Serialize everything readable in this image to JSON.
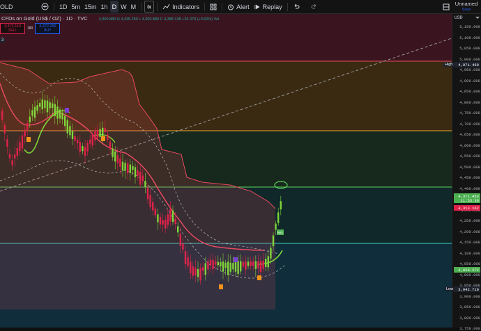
{
  "toolbar": {
    "symbol": "OLD",
    "add_icon": "plus-circle-icon",
    "intervals": [
      "1D",
      "5m",
      "15m",
      "1h",
      "D",
      "W",
      "M"
    ],
    "active_interval": "D",
    "chart_type_icon": "candles-icon",
    "indicators_label": "Indicators",
    "alert_label": "Alert",
    "replay_label": "Replay",
    "layout_name": "Unnamed",
    "layout_sub": "Save"
  },
  "legend": {
    "title": "CFDs on Gold (US$ / OZ) · 1D · TVC",
    "ohlc": "4,300.880 H 4,435.250 L 4,300.880 C 4,388.138 +26.378 (+0.60%) Vol",
    "sell_price": "4,372.110",
    "sell_label": "SELL",
    "spread": "180",
    "buy_price": "4,372.290",
    "buy_label": "BUY",
    "count": "3"
  },
  "axis": {
    "currency": "USD",
    "ticks": [
      "5,150.000",
      "5,100.000",
      "5,050.000",
      "5,000.000",
      "4,950.000",
      "4,900.000",
      "4,850.000",
      "4,800.000",
      "4,750.000",
      "4,700.000",
      "4,650.000",
      "4,600.000",
      "4,550.000",
      "4,500.000",
      "4,450.000",
      "4,400.000",
      "4,350.000",
      "4,300.000",
      "4,250.000",
      "4,200.000",
      "4,150.000",
      "4,100.000",
      "4,050.000",
      "4,000.000",
      "3,950.000",
      "3,900.000",
      "3,850.000",
      "3,800.000",
      "3,750.000"
    ],
    "high_label": "High",
    "high_value": "4,971.469",
    "price_value": "4,371.453",
    "price_time": "11:53:38",
    "red_value": "4,313.162",
    "green_value": "4,028.272",
    "low_label": "Low",
    "low_value": "3,942.710"
  },
  "annotations": {
    "key_label": "key"
  },
  "colors": {
    "bull": "#7fd43a",
    "bear": "#e0224a",
    "band": "#e84a5f",
    "gold_line": "#f7a531",
    "green_line": "#5fd35f",
    "cyan_line": "#3bd3c8"
  }
}
